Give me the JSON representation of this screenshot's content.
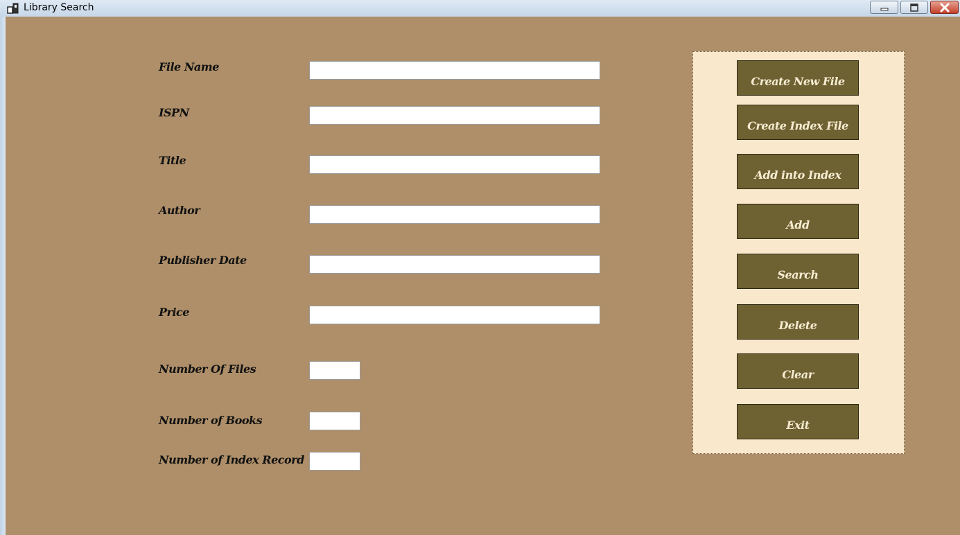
{
  "window": {
    "title": "Library Search",
    "icons": {
      "app": "app-icon",
      "minimize": "minimize-icon",
      "maximize": "maximize-icon",
      "close": "close-icon"
    }
  },
  "form": {
    "file_name": {
      "label": "File Name",
      "value": ""
    },
    "ispn": {
      "label": "ISPN",
      "value": ""
    },
    "title": {
      "label": "Title",
      "value": ""
    },
    "author": {
      "label": "Author",
      "value": ""
    },
    "publisher_date": {
      "label": "Publisher Date",
      "value": ""
    },
    "price": {
      "label": "Price",
      "value": ""
    },
    "number_of_files": {
      "label": "Number Of Files",
      "value": ""
    },
    "number_of_books": {
      "label": "Number of Books",
      "value": ""
    },
    "number_of_index_record": {
      "label": "Number of Index Record",
      "value": ""
    }
  },
  "actions": {
    "create_new_file": "Create New File",
    "create_index_file": "Create Index File",
    "add_into_index": "Add into Index",
    "add": "Add",
    "search": "Search",
    "delete": "Delete",
    "clear": "Clear",
    "exit": "Exit"
  },
  "colors": {
    "form_background": "#ae8f69",
    "panel_background": "#fae8cd",
    "button_background": "#6e6132",
    "button_text": "#f6ecd2"
  }
}
